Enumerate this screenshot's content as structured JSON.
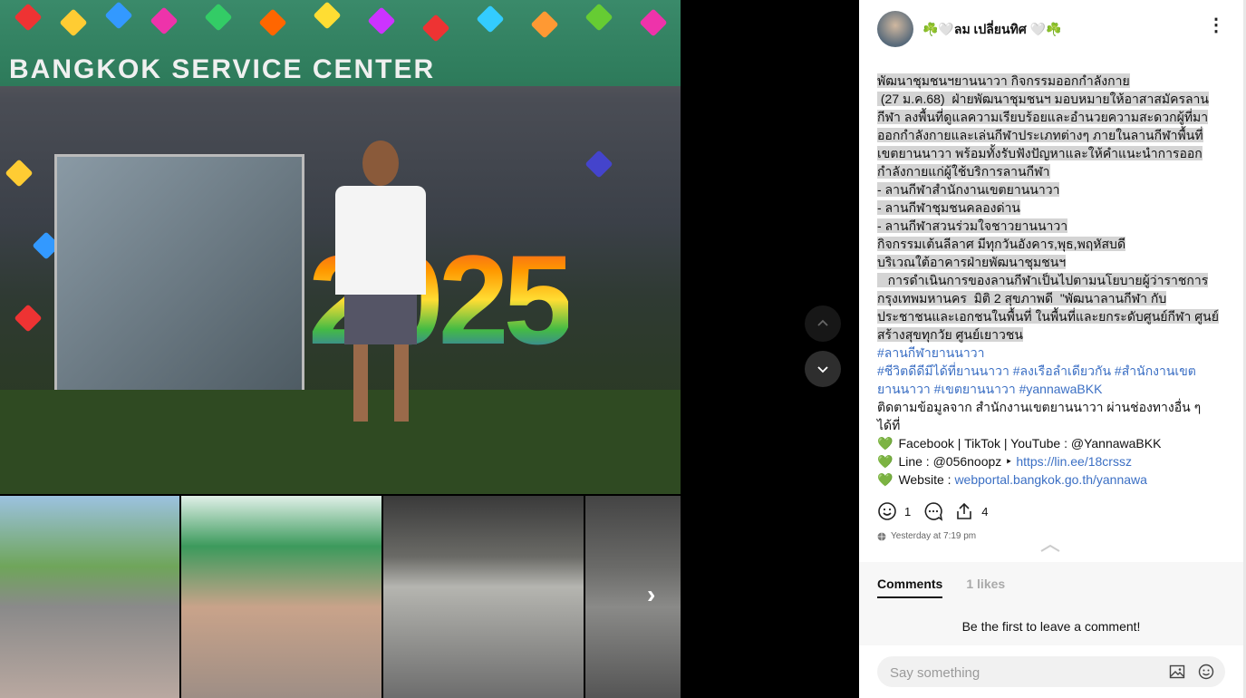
{
  "media": {
    "banner_text": "BANGKOK SERVICE CENTER",
    "digits_text": "2025",
    "next_arrow": "›",
    "nav_up_icon": "chevron-up-icon",
    "nav_down_icon": "chevron-down-icon"
  },
  "post": {
    "author": "☘️🤍ลม เปลี่ยนทิศ 🤍☘️",
    "more_icon": "⋮",
    "body_highlighted_lines": [
      "พัฒนาชุมชนฯยานนาวา กิจกรรมออกกำลังกาย",
      " (27 ม.ค.68)  ฝ่ายพัฒนาชุมชนฯ มอบหมายให้อาสาสมัครลาน",
      "กีฬา ลงพื้นที่ดูแลความเรียบร้อยและอำนวยความสะดวกผู้ที่มา",
      "ออกกำลังกายและเล่นกีฬาประเภทต่างๆ ภายในลานกีฬาพื้นที่",
      "เขตยานนาวา พร้อมทั้งรับฟังปัญหาและให้คำแนะนำการออก",
      "กำลังกายแก่ผู้ใช้บริการลานกีฬา",
      "- ลานกีฬาสำนักงานเขตยานนาวา",
      "- ลานกีฬาชุมชนคลองด่าน",
      "- ลานกีฬาสวนร่วมใจชาวยานนาวา",
      "กิจกรรมเต้นลีลาศ มีทุกวันอังคาร,พุธ,พฤหัสบดี",
      "บริเวณใต้อาคารฝ่ายพัฒนาชุมชนฯ",
      "   การดำเนินการของลานกีฬาเป็นไปตามนโยบายผู้ว่าราชการ",
      "กรุงเทพมหานคร  มิติ 2 สุขภาพดี  \"พัฒนาลานกีฬา กับ",
      "ประชาชนและเอกชนในพื้นที่ ในพื้นที่และยกระดับศูนย์กีฬา ศูนย์",
      "สร้างสุขทุกวัย ศูนย์เยาวชน"
    ],
    "hashtag_line1": "#ลานกีฬายานนาวา",
    "hashtag_line2": "#ชีวิตดีดีมีได้ที่ยานนาวา #ลงเรือลำเดียวกัน #สำนักงานเขต",
    "hashtag_line3": "ยานนาวา #เขตยานนาวา #yannawaBKK",
    "follow_line1": "ติดตามข้อมูลจาก สำนักงานเขตยานนาวา ผ่านช่องทางอื่น ๆ",
    "follow_line2": "ได้ที่",
    "heart_glyph": "💚",
    "channels": {
      "facebook_text": "Facebook | TikTok | YouTube : @YannawaBKK",
      "line_prefix": "Line : @056noopz ‣ ",
      "line_link": "https://lin.ee/18crssz",
      "website_prefix": "Website : ",
      "website_link": "webportal.bangkok.go.th/yannawa"
    },
    "reactions_count": "1",
    "shares_count": "4",
    "timestamp": "Yesterday at 7:19 pm"
  },
  "comments": {
    "tab_comments": "Comments",
    "tab_likes": "1 likes",
    "empty_text": "Be the first to leave a comment!",
    "input_placeholder": "Say something"
  }
}
